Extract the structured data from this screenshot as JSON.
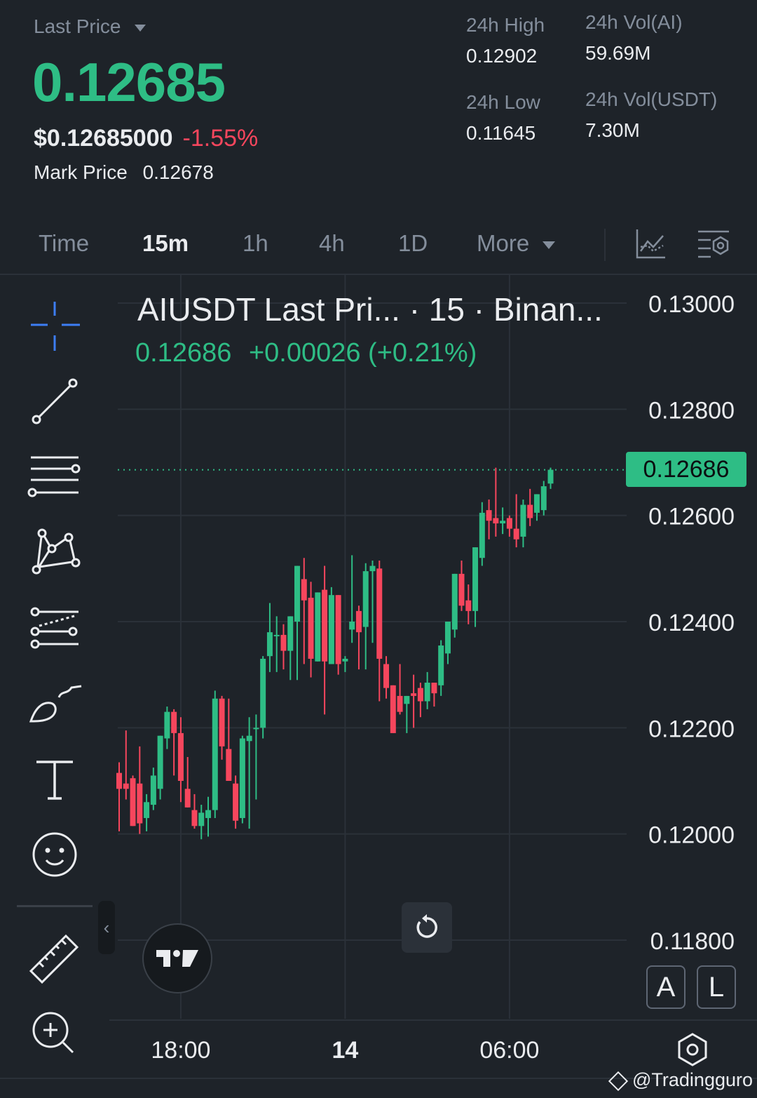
{
  "header": {
    "last_price_label": "Last Price",
    "last_price": "0.12685",
    "usd_price": "$0.12685000",
    "change_pct": "-1.55%",
    "mark_price_label": "Mark Price",
    "mark_price": "0.12678",
    "stats": {
      "high_label": "24h High",
      "high": "0.12902",
      "low_label": "24h Low",
      "low": "0.11645",
      "vol_ai_label": "24h Vol(AI)",
      "vol_ai": "59.69M",
      "vol_usdt_label": "24h Vol(USDT)",
      "vol_usdt": "7.30M"
    },
    "colors": {
      "up": "#2ebd85",
      "down": "#f6465d",
      "bg": "#1e2329"
    }
  },
  "tabs": [
    {
      "label": "Time",
      "active": false
    },
    {
      "label": "15m",
      "active": true
    },
    {
      "label": "1h",
      "active": false
    },
    {
      "label": "4h",
      "active": false
    },
    {
      "label": "1D",
      "active": false
    },
    {
      "label": "More",
      "active": false
    }
  ],
  "toolbar": {
    "tools": [
      "crosshair-icon",
      "trend-line-icon",
      "horizontal-lines-icon",
      "pattern-icon",
      "fib-icon",
      "brush-icon",
      "text-icon",
      "emoji-icon",
      "ruler-icon",
      "zoom-in-icon"
    ],
    "collapse_label": "‹"
  },
  "chart_data": {
    "type": "candlestick",
    "title": "AIUSDT Last Pri...  · 15 · Binan...",
    "last_value": "0.12686",
    "last_change": "+0.00026 (+0.21%)",
    "price_tag": "0.12686",
    "current_price": 0.12686,
    "ylim": [
      0.117,
      0.1307
    ],
    "yticks": [
      "0.13000",
      "0.12800",
      "0.12600",
      "0.12400",
      "0.12200",
      "0.12000",
      "0.11800"
    ],
    "ytick_values": [
      0.13,
      0.128,
      0.126,
      0.124,
      0.122,
      0.12,
      0.118
    ],
    "xticks": [
      {
        "label": "18:00",
        "index": 9
      },
      {
        "label": "14",
        "index": 33
      },
      {
        "label": "06:00",
        "index": 57
      }
    ],
    "axis_buttons": [
      "A",
      "L"
    ],
    "candles": [
      {
        "o": 0.12115,
        "h": 0.12135,
        "l": 0.12005,
        "c": 0.12085
      },
      {
        "o": 0.12095,
        "h": 0.12195,
        "l": 0.12065,
        "c": 0.12085
      },
      {
        "o": 0.12105,
        "h": 0.1211,
        "l": 0.12055,
        "c": 0.12015
      },
      {
        "o": 0.12095,
        "h": 0.12165,
        "l": 0.12,
        "c": 0.1202
      },
      {
        "o": 0.1203,
        "h": 0.12075,
        "l": 0.12005,
        "c": 0.1206
      },
      {
        "o": 0.12055,
        "h": 0.12125,
        "l": 0.12045,
        "c": 0.1211
      },
      {
        "o": 0.12085,
        "h": 0.1217,
        "l": 0.12065,
        "c": 0.12185
      },
      {
        "o": 0.1218,
        "h": 0.1224,
        "l": 0.1216,
        "c": 0.1223
      },
      {
        "o": 0.1223,
        "h": 0.12235,
        "l": 0.1211,
        "c": 0.1219
      },
      {
        "o": 0.1219,
        "h": 0.1222,
        "l": 0.1206,
        "c": 0.121
      },
      {
        "o": 0.12085,
        "h": 0.12145,
        "l": 0.12055,
        "c": 0.1205
      },
      {
        "o": 0.12045,
        "h": 0.12075,
        "l": 0.1201,
        "c": 0.12015
      },
      {
        "o": 0.12015,
        "h": 0.12055,
        "l": 0.1199,
        "c": 0.1204
      },
      {
        "o": 0.1203,
        "h": 0.1207,
        "l": 0.11995,
        "c": 0.12045
      },
      {
        "o": 0.12045,
        "h": 0.1227,
        "l": 0.1203,
        "c": 0.12255
      },
      {
        "o": 0.12255,
        "h": 0.1226,
        "l": 0.1214,
        "c": 0.12165
      },
      {
        "o": 0.1216,
        "h": 0.12255,
        "l": 0.121,
        "c": 0.121
      },
      {
        "o": 0.12095,
        "h": 0.1211,
        "l": 0.1201,
        "c": 0.12025
      },
      {
        "o": 0.1203,
        "h": 0.12185,
        "l": 0.1202,
        "c": 0.1218
      },
      {
        "o": 0.12175,
        "h": 0.1222,
        "l": 0.1201,
        "c": 0.12185
      },
      {
        "o": 0.122,
        "h": 0.12225,
        "l": 0.12065,
        "c": 0.122
      },
      {
        "o": 0.122,
        "h": 0.12335,
        "l": 0.1218,
        "c": 0.1233
      },
      {
        "o": 0.12335,
        "h": 0.12435,
        "l": 0.12305,
        "c": 0.1238
      },
      {
        "o": 0.12375,
        "h": 0.1241,
        "l": 0.12305,
        "c": 0.12375
      },
      {
        "o": 0.12375,
        "h": 0.12395,
        "l": 0.1231,
        "c": 0.12345
      },
      {
        "o": 0.12345,
        "h": 0.1238,
        "l": 0.1229,
        "c": 0.1241
      },
      {
        "o": 0.124,
        "h": 0.12485,
        "l": 0.1229,
        "c": 0.12505
      },
      {
        "o": 0.1248,
        "h": 0.1252,
        "l": 0.1232,
        "c": 0.1244
      },
      {
        "o": 0.12445,
        "h": 0.12475,
        "l": 0.12295,
        "c": 0.1233
      },
      {
        "o": 0.12325,
        "h": 0.12455,
        "l": 0.12335,
        "c": 0.12455
      },
      {
        "o": 0.1246,
        "h": 0.12505,
        "l": 0.12225,
        "c": 0.12325
      },
      {
        "o": 0.1232,
        "h": 0.12465,
        "l": 0.1232,
        "c": 0.1245
      },
      {
        "o": 0.1245,
        "h": 0.1232,
        "l": 0.123,
        "c": 0.1232
      },
      {
        "o": 0.12325,
        "h": 0.12335,
        "l": 0.12305,
        "c": 0.1233
      },
      {
        "o": 0.12385,
        "h": 0.12525,
        "l": 0.1236,
        "c": 0.124
      },
      {
        "o": 0.1242,
        "h": 0.1243,
        "l": 0.1231,
        "c": 0.1238
      },
      {
        "o": 0.1239,
        "h": 0.1251,
        "l": 0.1231,
        "c": 0.12495
      },
      {
        "o": 0.12495,
        "h": 0.12515,
        "l": 0.1236,
        "c": 0.12505
      },
      {
        "o": 0.125,
        "h": 0.12515,
        "l": 0.1225,
        "c": 0.1233
      },
      {
        "o": 0.1232,
        "h": 0.12335,
        "l": 0.12255,
        "c": 0.12275
      },
      {
        "o": 0.1228,
        "h": 0.12205,
        "l": 0.1219,
        "c": 0.1219
      },
      {
        "o": 0.1226,
        "h": 0.1232,
        "l": 0.12225,
        "c": 0.1223
      },
      {
        "o": 0.12245,
        "h": 0.1226,
        "l": 0.1219,
        "c": 0.1226
      },
      {
        "o": 0.12265,
        "h": 0.123,
        "l": 0.122,
        "c": 0.1226
      },
      {
        "o": 0.12275,
        "h": 0.12285,
        "l": 0.1222,
        "c": 0.1225
      },
      {
        "o": 0.1225,
        "h": 0.12305,
        "l": 0.12235,
        "c": 0.12285
      },
      {
        "o": 0.12285,
        "h": 0.12265,
        "l": 0.1224,
        "c": 0.12265
      },
      {
        "o": 0.1228,
        "h": 0.12365,
        "l": 0.1226,
        "c": 0.12355
      },
      {
        "o": 0.1234,
        "h": 0.124,
        "l": 0.1232,
        "c": 0.124
      },
      {
        "o": 0.12385,
        "h": 0.1246,
        "l": 0.1237,
        "c": 0.1249
      },
      {
        "o": 0.1249,
        "h": 0.12515,
        "l": 0.1242,
        "c": 0.1243
      },
      {
        "o": 0.1244,
        "h": 0.1247,
        "l": 0.12395,
        "c": 0.1242
      },
      {
        "o": 0.1242,
        "h": 0.1253,
        "l": 0.1239,
        "c": 0.1254
      },
      {
        "o": 0.1252,
        "h": 0.12625,
        "l": 0.12505,
        "c": 0.12605
      },
      {
        "o": 0.1261,
        "h": 0.1263,
        "l": 0.12555,
        "c": 0.1259
      },
      {
        "o": 0.12595,
        "h": 0.1269,
        "l": 0.1256,
        "c": 0.12585
      },
      {
        "o": 0.12585,
        "h": 0.12615,
        "l": 0.12565,
        "c": 0.1259
      },
      {
        "o": 0.12595,
        "h": 0.126,
        "l": 0.1256,
        "c": 0.12575
      },
      {
        "o": 0.12575,
        "h": 0.1264,
        "l": 0.1254,
        "c": 0.12555
      },
      {
        "o": 0.1256,
        "h": 0.1263,
        "l": 0.1254,
        "c": 0.1262
      },
      {
        "o": 0.1262,
        "h": 0.1265,
        "l": 0.1258,
        "c": 0.12595
      },
      {
        "o": 0.12605,
        "h": 0.1264,
        "l": 0.1259,
        "c": 0.1264
      },
      {
        "o": 0.1261,
        "h": 0.12665,
        "l": 0.126,
        "c": 0.12655
      },
      {
        "o": 0.1266,
        "h": 0.1269,
        "l": 0.1265,
        "c": 0.12686
      }
    ]
  },
  "watermark": "@Tradingguro"
}
